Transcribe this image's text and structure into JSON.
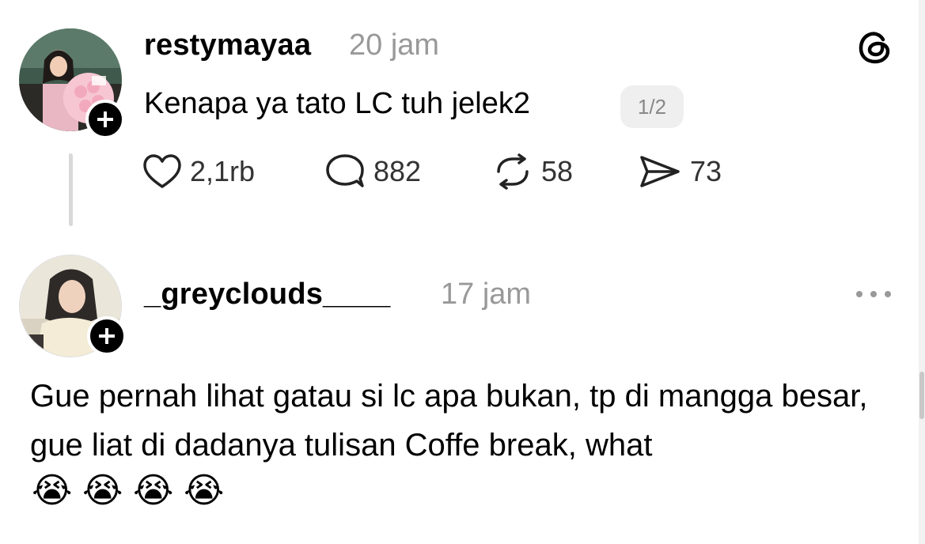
{
  "post": {
    "username": "restymayaa",
    "time": "20 jam",
    "text": "Kenapa ya tato LC tuh jelek2",
    "pager": "1/2",
    "likes": "2,1rb",
    "comments": "882",
    "reposts": "58",
    "shares": "73"
  },
  "reply": {
    "username": "_greyclouds____",
    "time": "17 jam",
    "text": "Gue pernah lihat gatau si lc apa bukan, tp di mangga besar, gue liat di dadanya tulisan Coffe break, what",
    "emojis": [
      "😭",
      "😭",
      "😭",
      "😭"
    ]
  },
  "icons": {
    "app_logo": "threads-logo-icon",
    "like": "heart-icon",
    "comment": "comment-bubble-icon",
    "repost": "repost-icon",
    "share": "send-icon",
    "more": "more-options-icon",
    "follow": "plus-icon"
  },
  "colors": {
    "text": "#000000",
    "muted": "#999999",
    "pager_bg": "#efefef"
  }
}
